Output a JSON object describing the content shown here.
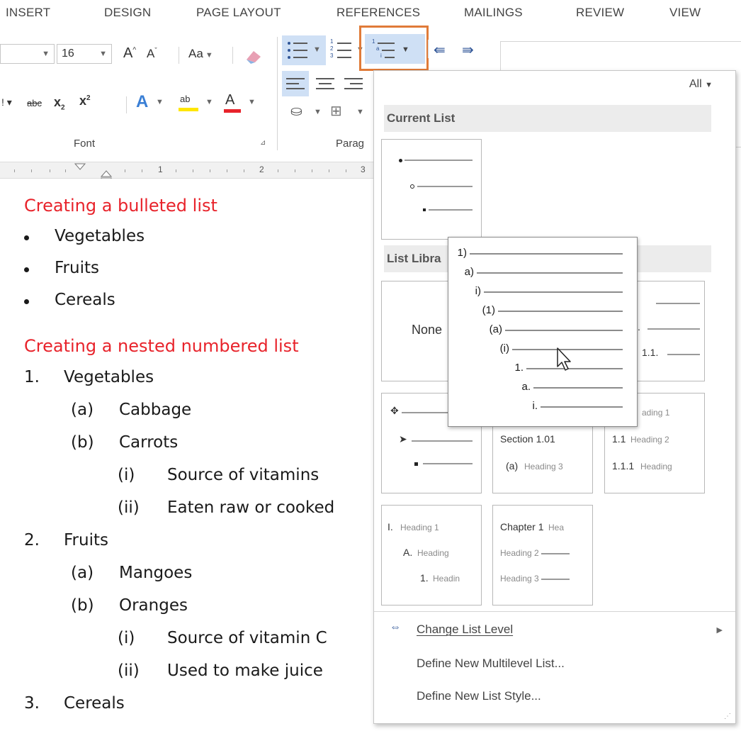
{
  "ribbon_tabs": [
    "INSERT",
    "DESIGN",
    "PAGE LAYOUT",
    "REFERENCES",
    "MAILINGS",
    "REVIEW",
    "VIEW"
  ],
  "font_group": {
    "font_size": "16",
    "change_case": "Aa",
    "strikethrough": "abc",
    "subscript": "x",
    "superscript": "x",
    "label": "Font"
  },
  "paragraph_group": {
    "label": "Parag"
  },
  "ruler": {
    "numbers": [
      "1",
      "2",
      "3"
    ]
  },
  "document": {
    "heading1": "Creating a bulleted list",
    "bullets": [
      "Vegetables",
      "Fruits",
      "Cereals"
    ],
    "heading2": "Creating a nested numbered list",
    "numbered": [
      {
        "marker": "1.",
        "text": "Vegetables",
        "level": 0
      },
      {
        "marker": "(a)",
        "text": "Cabbage",
        "level": 1
      },
      {
        "marker": "(b)",
        "text": "Carrots",
        "level": 1
      },
      {
        "marker": "(i)",
        "text": "Source of vitamins",
        "level": 2
      },
      {
        "marker": "(ii)",
        "text": "Eaten raw or cooked",
        "level": 2
      },
      {
        "marker": "2.",
        "text": "Fruits",
        "level": 0
      },
      {
        "marker": "(a)",
        "text": "Mangoes",
        "level": 1
      },
      {
        "marker": "(b)",
        "text": "Oranges",
        "level": 1
      },
      {
        "marker": "(i)",
        "text": "Source of vitamin C",
        "level": 2
      },
      {
        "marker": "(ii)",
        "text": "Used to make juice",
        "level": 2
      },
      {
        "marker": "3.",
        "text": "Cereals",
        "level": 0
      }
    ]
  },
  "menu": {
    "filter": "All",
    "current_list_title": "Current List",
    "list_library_title": "List Libra",
    "none_label": "None",
    "thumb_numbered_right": "1.1.",
    "section_thumb": {
      "line1": "Section 1.01",
      "line2": "(a)",
      "line2_small": "Heading 3"
    },
    "heading_thumb": {
      "line1_small": "ading 1",
      "line2": "1.1",
      "line2_small": "Heading 2",
      "line3": "1.1.1",
      "line3_small": "Heading"
    },
    "roman_thumb": {
      "line1": "I.",
      "line1_small": "Heading 1",
      "line2": "A.",
      "line2_small": "Heading",
      "line3": "1.",
      "line3_small": "Headin"
    },
    "chapter_thumb": {
      "line1": "Chapter 1",
      "line1_small": "Hea",
      "line2_small": "Heading 2",
      "line3_small": "Heading 3"
    },
    "items": [
      {
        "label": "Change List Level",
        "has_submenu": true
      },
      {
        "label": "Define New Multilevel List...",
        "has_submenu": false
      },
      {
        "label": "Define New List Style...",
        "has_submenu": false
      }
    ]
  },
  "preview": {
    "levels": [
      "1)",
      "a)",
      "i)",
      "(1)",
      "(a)",
      "(i)",
      "1.",
      "a.",
      "i."
    ]
  },
  "colors": {
    "accent_orange": "#e07b39",
    "heading_red": "#e8232b",
    "highlight_blue": "#cfe0f5"
  }
}
